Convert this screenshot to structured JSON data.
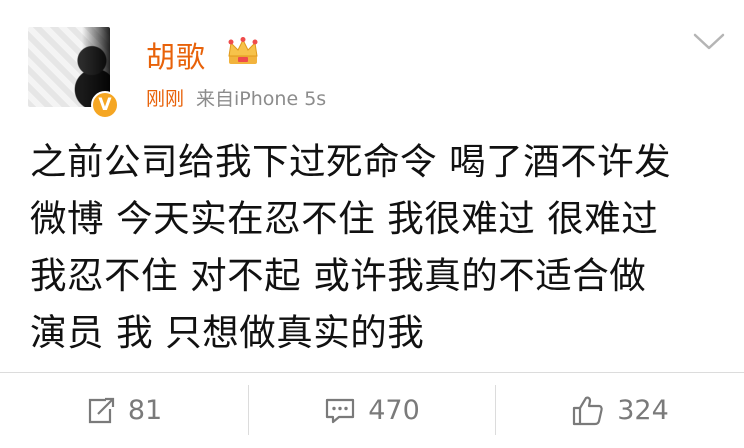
{
  "user": {
    "name": "胡歌",
    "verified": "V",
    "time": "刚刚",
    "source": "来自iPhone 5s"
  },
  "post": {
    "lines": [
      "之前公司给我下过死命令 喝了酒不许发",
      "微博 今天实在忍不住 我很难过 很难过",
      "我忍不住 对不起 或许我真的不适合做",
      "演员 我 只想做真实的我"
    ]
  },
  "actions": {
    "repost_count": "81",
    "comment_count": "470",
    "like_count": "324"
  },
  "colors": {
    "accent": "#e8620a",
    "meta_text": "#8c8c8c",
    "action_text": "#7a7a7a",
    "divider": "#dcdcdc",
    "verified_badge": "#f5a623"
  },
  "icons": {
    "crown": "crown-icon",
    "chevron": "chevron-down-icon",
    "repost": "repost-icon",
    "comment": "comment-icon",
    "like": "like-icon"
  }
}
